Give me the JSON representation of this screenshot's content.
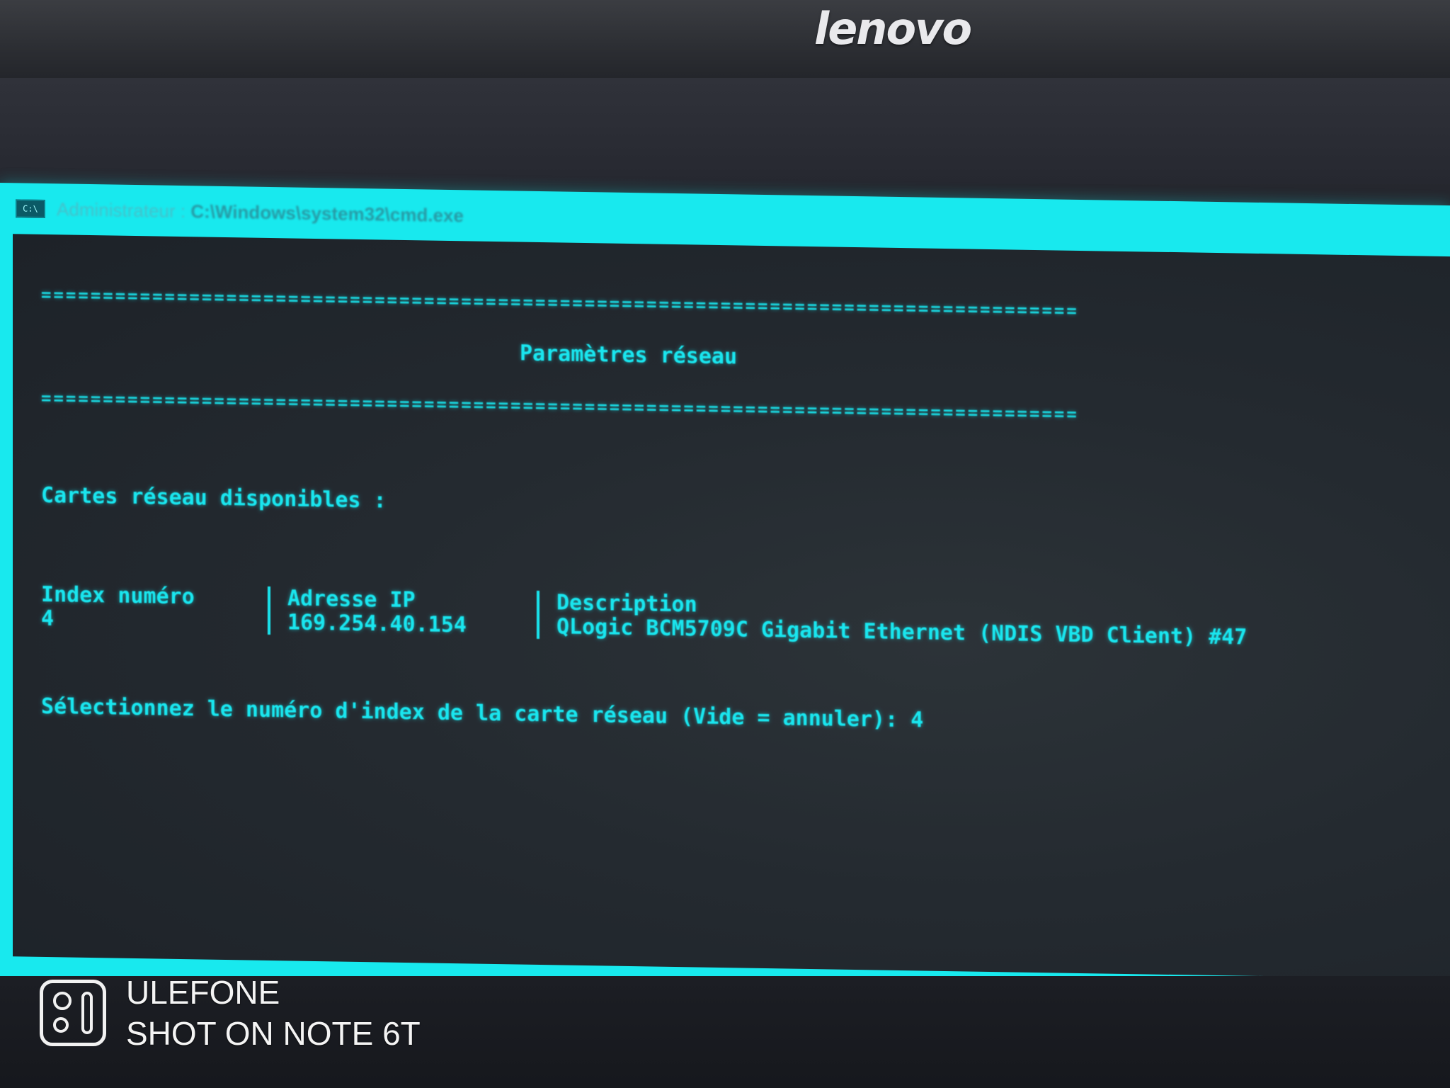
{
  "monitor": {
    "brand": "lenovo"
  },
  "window": {
    "title": "Administrateur : C:\\Windows\\system32\\cmd.exe",
    "title_prefix": "Administrateur :",
    "title_path": "C:\\Windows\\system32\\cmd.exe",
    "icon_label": "C:\\"
  },
  "console": {
    "rule_top": "====================================================================================",
    "heading": "Paramètres réseau",
    "rule_bottom": "====================================================================================",
    "section_label": "Cartes réseau disponibles :",
    "table": {
      "headers": [
        "Index numéro",
        "Adresse IP",
        "Description"
      ],
      "rows": [
        [
          "4",
          "169.254.40.154",
          "QLogic BCM5709C Gigabit Ethernet (NDIS VBD Client) #47"
        ]
      ]
    },
    "prompt": "Sélectionnez le numéro d'index de la carte réseau (Vide = annuler): 4"
  },
  "watermark": {
    "line1": "ULEFONE",
    "line2": "SHOT ON NOTE 6T"
  },
  "colors": {
    "terminal_text": "#19e6ef",
    "window_frame": "#18e9ee",
    "terminal_bg": "#242a30"
  }
}
